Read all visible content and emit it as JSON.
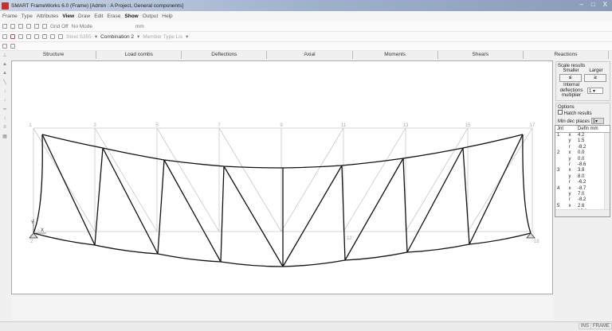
{
  "window": {
    "title": "SMART FrameWorks 6.0 (Frame) [Admin : A Project, General components]",
    "controls": [
      "–",
      "□",
      "X"
    ]
  },
  "menu": [
    "Frame",
    "Type",
    "Attributes",
    "View",
    "Draw",
    "Edit",
    "Erase",
    "Show",
    "Output",
    "Help"
  ],
  "toolbar1": {
    "grid": "Grid Off",
    "mode": "No Mode",
    "units": "mm"
  },
  "toolbar2": {
    "material": "Steel S355",
    "combination": "Combination 2",
    "member_type": "Member Type Lis"
  },
  "tabs": [
    "Structure",
    "Load combs",
    "Deflections",
    "Axial",
    "Moments",
    "Shears",
    "Reactions"
  ],
  "panel": {
    "scale_title": "Scale results",
    "smaller": "Smaller",
    "larger": "Larger",
    "smaller_btn": "≤",
    "larger_btn": "≥",
    "internal_label": "Internal",
    "deflections_label": "deflections",
    "multiplier_label": "multiplier",
    "multiplier_value": "1",
    "options_title": "Options",
    "hatch_label": "Hatch results",
    "hatch_checked": false,
    "min_dec_label": "Min dec places",
    "min_dec_value": "1",
    "table": {
      "headers": [
        "Jnt",
        "",
        "Defln mm"
      ],
      "rows": [
        [
          "1",
          "x",
          "4.2"
        ],
        [
          "",
          "y",
          "1.5"
        ],
        [
          "",
          "r",
          "-8.2"
        ],
        [
          "2",
          "x",
          "0.0"
        ],
        [
          "",
          "y",
          "0.0"
        ],
        [
          "",
          "r",
          "-8.6"
        ],
        [
          "3",
          "x",
          "3.8"
        ],
        [
          "",
          "y",
          "8.0"
        ],
        [
          "",
          "r",
          "-6.2"
        ],
        [
          "4",
          "x",
          "-8.7"
        ],
        [
          "",
          "y",
          "7.0"
        ],
        [
          "",
          "r",
          "-8.2"
        ],
        [
          "5",
          "x",
          "2.6"
        ],
        [
          "",
          "y",
          "13.1"
        ],
        [
          "",
          "r",
          "-8.7"
        ]
      ]
    }
  },
  "canvas": {
    "node_labels_top": [
      "1",
      "3",
      "5",
      "7",
      "9",
      "11",
      "13",
      "15",
      "17"
    ],
    "node_labels_bottom": [
      "2",
      "12",
      "16"
    ],
    "axis_x": "X",
    "axis_y": "Y",
    "deformed_color": "#111111",
    "original_color": "#c8c8c8"
  },
  "status": {
    "ins": "INS",
    "mode": "FRAME"
  }
}
